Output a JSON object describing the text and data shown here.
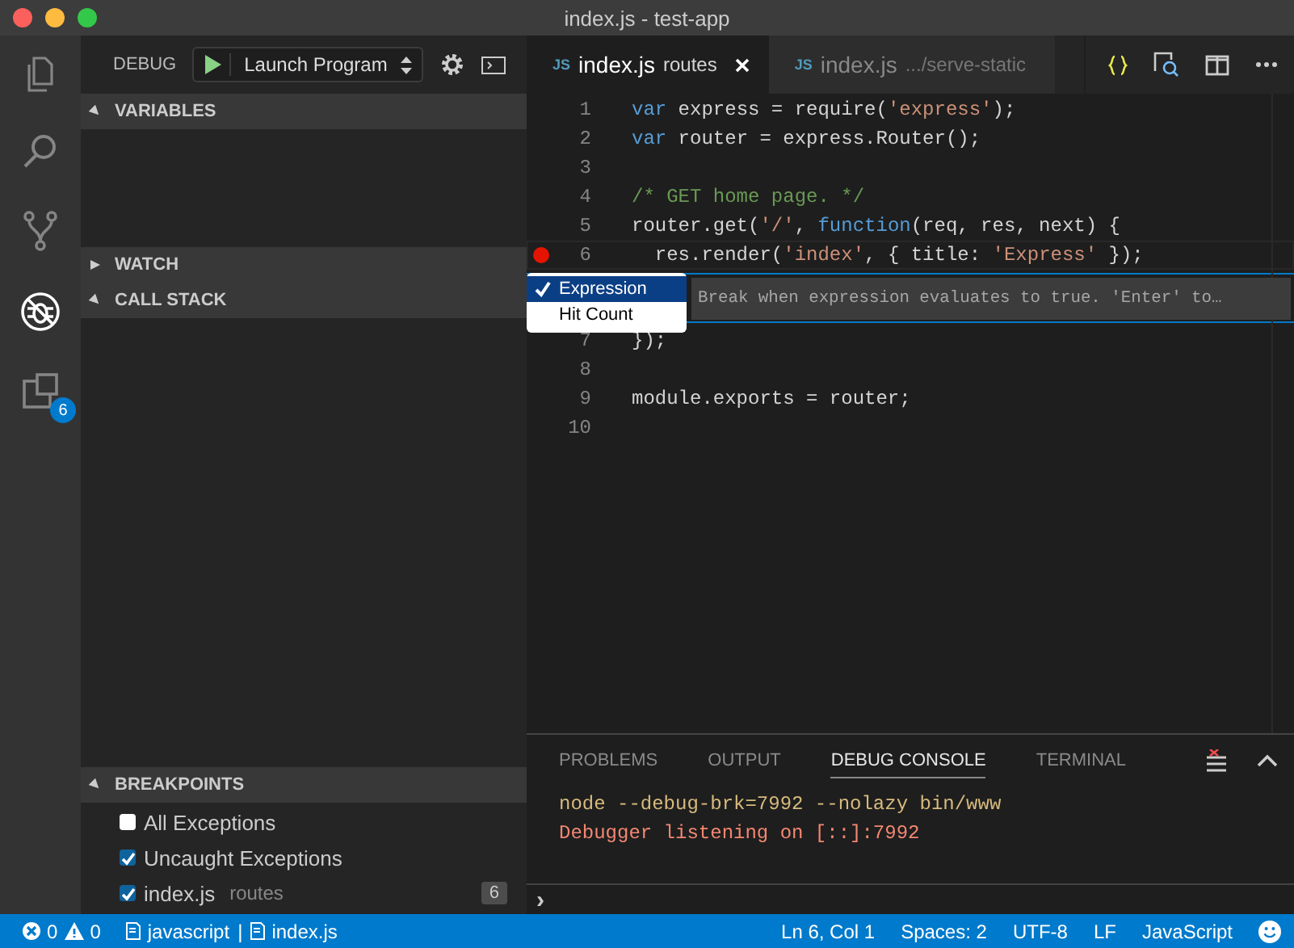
{
  "window": {
    "title": "index.js - test-app"
  },
  "activity_bar": [
    {
      "kind": "files",
      "selected": false
    },
    {
      "kind": "search",
      "selected": false
    },
    {
      "kind": "git",
      "selected": false
    },
    {
      "kind": "debug",
      "selected": true
    },
    {
      "kind": "extensions",
      "selected": false,
      "badge": "6"
    }
  ],
  "debug_toolbar": {
    "label": "DEBUG",
    "configuration": "Launch Program"
  },
  "sidebar": {
    "sections": [
      {
        "kind": "variables",
        "title": "VARIABLES",
        "expanded": true
      },
      {
        "kind": "watch",
        "title": "WATCH",
        "expanded": false
      },
      {
        "kind": "callstack",
        "title": "CALL STACK",
        "expanded": true
      },
      {
        "kind": "breakpoints",
        "title": "BREAKPOINTS",
        "expanded": true
      }
    ],
    "breakpoints": [
      {
        "label": "All Exceptions",
        "checked": false
      },
      {
        "label": "Uncaught Exceptions",
        "checked": true
      },
      {
        "label": "index.js",
        "detail": "routes",
        "count": "6",
        "checked": true
      }
    ]
  },
  "editor": {
    "tabs": [
      {
        "icon": "JS",
        "name": "index.js",
        "detail": "routes",
        "selected": true
      },
      {
        "icon": "JS",
        "name": "index.js",
        "detail": ".../serve-static",
        "selected": false
      }
    ],
    "lines": [
      {
        "number": "1",
        "breakpoint": false,
        "tokens": [
          {
            "kind": "keyword",
            "text": "var"
          },
          {
            "kind": "plain",
            "text": " express = require("
          },
          {
            "kind": "string",
            "text": "'express'"
          },
          {
            "kind": "plain",
            "text": ");"
          }
        ]
      },
      {
        "number": "2",
        "breakpoint": false,
        "tokens": [
          {
            "kind": "keyword",
            "text": "var"
          },
          {
            "kind": "plain",
            "text": " router = express.Router();"
          }
        ]
      },
      {
        "number": "3",
        "breakpoint": false
      },
      {
        "number": "4",
        "breakpoint": false,
        "tokens": [
          {
            "kind": "comment",
            "text": "/* GET home page. */"
          }
        ]
      },
      {
        "number": "5",
        "breakpoint": false,
        "tokens": [
          {
            "kind": "plain",
            "text": "router.get("
          },
          {
            "kind": "string",
            "text": "'/'"
          },
          {
            "kind": "plain",
            "text": ", "
          },
          {
            "kind": "keyword",
            "text": "function"
          },
          {
            "kind": "plain",
            "text": "(req, res, next) {"
          }
        ]
      },
      {
        "number": "6",
        "breakpoint": true,
        "tokens": [
          {
            "kind": "plain",
            "text": "  res.render("
          },
          {
            "kind": "string",
            "text": "'index'"
          },
          {
            "kind": "plain",
            "text": ", { title: "
          },
          {
            "kind": "string",
            "text": "'Express'"
          },
          {
            "kind": "plain",
            "text": " });"
          }
        ]
      },
      {
        "number": "7",
        "breakpoint": false,
        "tokens": [
          {
            "kind": "plain",
            "text": "});"
          }
        ]
      },
      {
        "number": "8",
        "breakpoint": false
      },
      {
        "number": "9",
        "breakpoint": false,
        "tokens": [
          {
            "kind": "plain",
            "text": "module.exports = router;"
          }
        ]
      },
      {
        "number": "10",
        "breakpoint": false
      }
    ],
    "breakpoint_widget": {
      "menu": [
        {
          "label": "Expression",
          "selected": true
        },
        {
          "label": "Hit Count",
          "selected": false
        }
      ],
      "placeholder": "Break when expression evaluates to true. 'Enter' to…"
    }
  },
  "panel": {
    "tabs": [
      {
        "label": "PROBLEMS",
        "selected": false
      },
      {
        "label": "OUTPUT",
        "selected": false
      },
      {
        "label": "DEBUG CONSOLE",
        "selected": true
      },
      {
        "label": "TERMINAL",
        "selected": false
      }
    ],
    "console": [
      {
        "kind": "command",
        "text": "node --debug-brk=7992 --nolazy bin/www"
      },
      {
        "kind": "error",
        "text": "Debugger listening on [::]:7992"
      }
    ],
    "prompt": "›"
  },
  "status_bar": {
    "errors": "0",
    "warnings": "0",
    "language_mode": "javascript",
    "separator": "|",
    "file": "index.js",
    "right": [
      "Ln 6, Col 1",
      "Spaces: 2",
      "UTF-8",
      "LF",
      "JavaScript"
    ]
  }
}
